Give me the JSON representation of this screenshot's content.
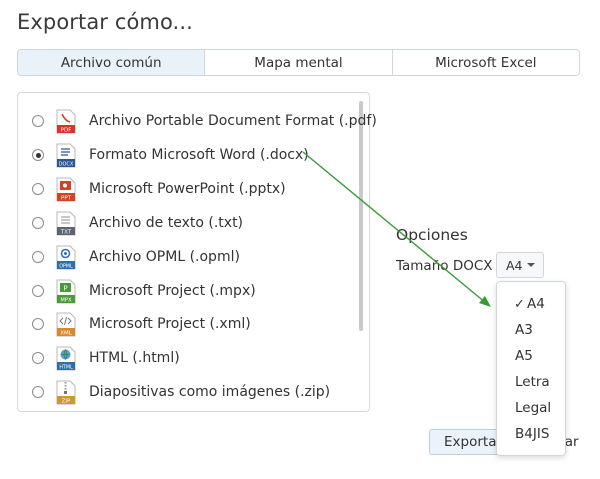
{
  "dialog": {
    "title": "Exportar cómo..."
  },
  "tabs": [
    {
      "label": "Archivo común",
      "active": true
    },
    {
      "label": "Mapa mental",
      "active": false
    },
    {
      "label": "Microsoft Excel",
      "active": false
    }
  ],
  "formats": [
    {
      "label": "Archivo Portable Document Format (.pdf)",
      "icon": "pdf-file-icon",
      "icon_text": "PDF",
      "color": "#d9342b",
      "checked": false
    },
    {
      "label": "Formato Microsoft Word (.docx)",
      "icon": "docx-file-icon",
      "icon_text": "DOCX",
      "color": "#2b5797",
      "checked": true
    },
    {
      "label": "Microsoft PowerPoint (.pptx)",
      "icon": "pptx-file-icon",
      "icon_text": "PPT",
      "color": "#d04423",
      "checked": false
    },
    {
      "label": "Archivo de texto (.txt)",
      "icon": "txt-file-icon",
      "icon_text": "TXT",
      "color": "#5d6670",
      "checked": false
    },
    {
      "label": "Archivo OPML (.opml)",
      "icon": "opml-file-icon",
      "icon_text": "OPML",
      "color": "#2f6fa8",
      "checked": false
    },
    {
      "label": "Microsoft Project (.mpx)",
      "icon": "mpx-file-icon",
      "icon_text": "MPX",
      "color": "#4a9a3a",
      "checked": false
    },
    {
      "label": "Microsoft Project (.xml)",
      "icon": "xml-file-icon",
      "icon_text": "XML",
      "color": "#d88a2a",
      "checked": false
    },
    {
      "label": "HTML (.html)",
      "icon": "html-file-icon",
      "icon_text": "HTML",
      "color": "#2f6fa8",
      "checked": false
    },
    {
      "label": "Diapositivas como imágenes (.zip)",
      "icon": "zip-file-icon",
      "icon_text": "ZIP",
      "color": "#c89b2a",
      "checked": false
    }
  ],
  "options": {
    "title": "Opciones",
    "size_label": "Tamaño DOCX",
    "size_value": "A4",
    "size_options": [
      "A4",
      "A3",
      "A5",
      "Letra",
      "Legal",
      "B4JIS"
    ],
    "checkmark": "✓"
  },
  "buttons": {
    "export": "Exportar",
    "cancel": "Cancelar"
  },
  "colors": {
    "tab_active_bg": "#e9f1f9",
    "arrow": "#3a9a3a",
    "button_primary_bg": "#eaf2fb"
  }
}
